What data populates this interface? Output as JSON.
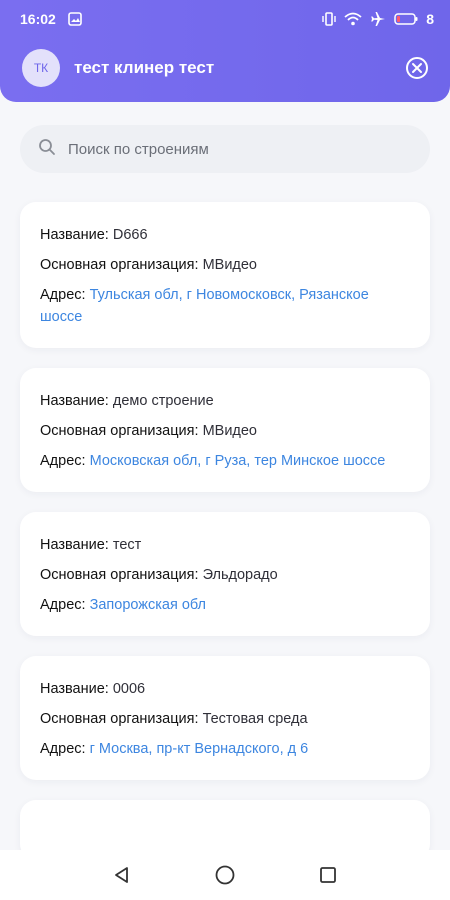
{
  "status_bar": {
    "time": "16:02",
    "battery": "8"
  },
  "app_bar": {
    "avatar_initials": "ТК",
    "user_name": "тест клинер тест"
  },
  "search": {
    "placeholder": "Поиск по строениям"
  },
  "labels": {
    "name": "Название:",
    "org": "Основная организация:",
    "address": "Адрес:"
  },
  "buildings": [
    {
      "name": "D666",
      "org": "МВидео",
      "address": "Тульская обл, г Новомосковск, Рязанское шоссе"
    },
    {
      "name": "демо строение",
      "org": "МВидео",
      "address": "Московская обл, г Руза, тер Минское шоссе"
    },
    {
      "name": "тест",
      "org": "Эльдорадо",
      "address": "Запорожская обл"
    },
    {
      "name": "0006",
      "org": "Тестовая среда",
      "address": "г Москва, пр-кт Вернадского, д 6"
    }
  ],
  "colors": {
    "header": "#6f66ea",
    "link": "#3d86e0",
    "background": "#f6f7fa"
  }
}
